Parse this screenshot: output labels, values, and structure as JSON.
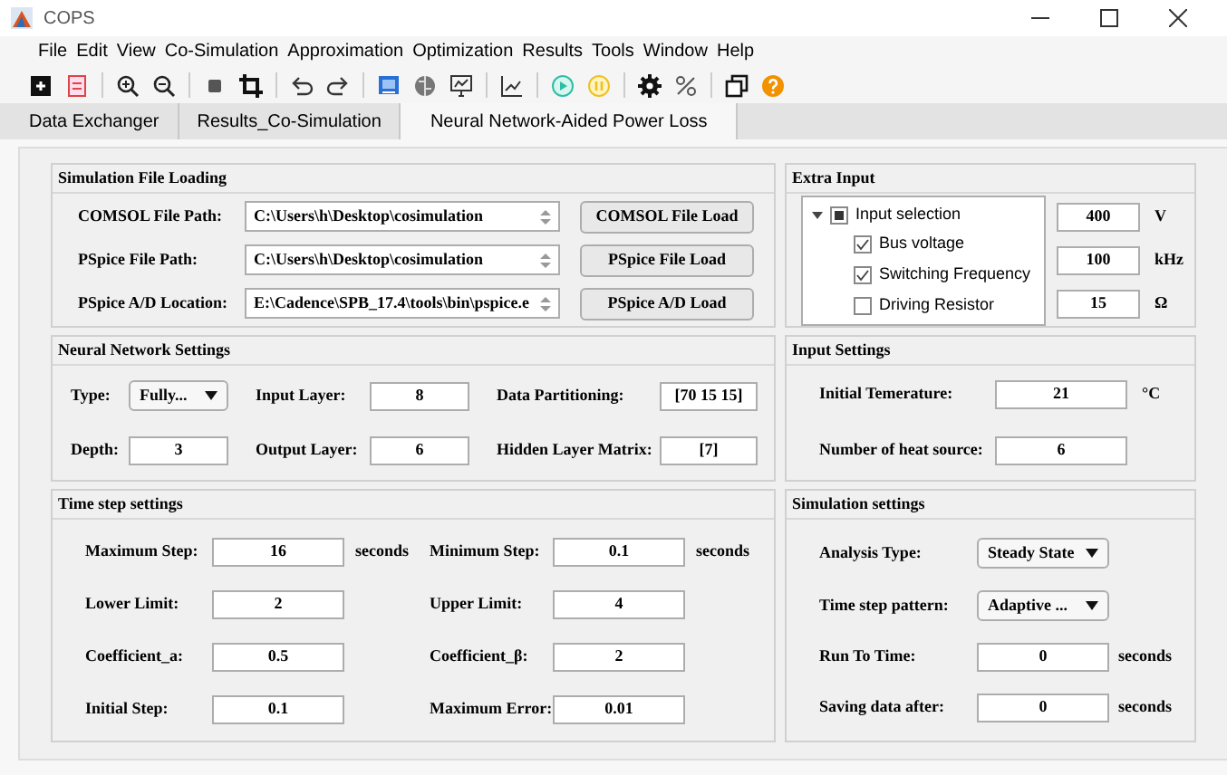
{
  "window": {
    "title": "COPS"
  },
  "menu": [
    "File",
    "Edit",
    "View",
    "Co-Simulation",
    "Approximation",
    "Optimization",
    "Results",
    "Tools",
    "Window",
    "Help"
  ],
  "tabs": [
    {
      "label": "Data Exchanger",
      "selected": false
    },
    {
      "label": "Results_Co-Simulation",
      "selected": false
    },
    {
      "label": "Neural Network-Aided Power Loss",
      "selected": true
    }
  ],
  "simulation_file_loading": {
    "title": "Simulation File Loading",
    "rows": [
      {
        "label": "COMSOL File Path:",
        "value": "C:\\Users\\h\\Desktop\\cosimulation",
        "button": "COMSOL File Load"
      },
      {
        "label": "PSpice File Path:",
        "value": "C:\\Users\\h\\Desktop\\cosimulation",
        "button": "PSpice File Load"
      },
      {
        "label": "PSpice A/D Location:",
        "value": "E:\\Cadence\\SPB_17.4\\tools\\bin\\pspice.e",
        "button": "PSpice A/D Load"
      }
    ]
  },
  "extra_input": {
    "title": "Extra Input",
    "tree": {
      "label": "Input selection",
      "expanded": true,
      "indeterminate": true,
      "children": [
        {
          "label": "Bus voltage",
          "checked": true
        },
        {
          "label": "Switching Frequency",
          "checked": true
        },
        {
          "label": "Driving Resistor",
          "checked": false
        }
      ]
    },
    "values": [
      {
        "value": "400",
        "unit": "V"
      },
      {
        "value": "100",
        "unit": "kHz"
      },
      {
        "value": "15",
        "unit": "Ω"
      }
    ]
  },
  "neural_network_settings": {
    "title": "Neural Network Settings",
    "rows": [
      [
        {
          "kind": "dropdown",
          "label": "Type:",
          "value": "Fully..."
        },
        {
          "kind": "field",
          "label": "Input Layer:",
          "value": "8"
        },
        {
          "kind": "field",
          "label": "Data Partitioning:",
          "value": "[70 15 15]"
        }
      ],
      [
        {
          "kind": "field",
          "label": "Depth:",
          "value": "3"
        },
        {
          "kind": "field",
          "label": "Output Layer:",
          "value": "6"
        },
        {
          "kind": "field",
          "label": "Hidden Layer Matrix:",
          "value": "[7]"
        }
      ]
    ]
  },
  "input_settings": {
    "title": "Input Settings",
    "rows": [
      {
        "label": "Initial Temerature:",
        "value": "21",
        "unit": "°C"
      },
      {
        "label": "Number of heat source:",
        "value": "6"
      }
    ]
  },
  "time_step_settings": {
    "title": "Time step  settings",
    "rows": [
      [
        {
          "label": "Maximum Step:",
          "value": "16",
          "unit": "seconds"
        },
        {
          "label": "Minimum Step:",
          "value": "0.1",
          "unit": "seconds"
        }
      ],
      [
        {
          "label": "Lower Limit:",
          "value": "2"
        },
        {
          "label": "Upper Limit:",
          "value": "4"
        }
      ],
      [
        {
          "label": "Coefficient_a:",
          "value": "0.5"
        },
        {
          "label": "Coefficient_β:",
          "value": "2"
        }
      ],
      [
        {
          "label": "Initial  Step:",
          "value": "0.1"
        },
        {
          "label": "Maximum Error:",
          "value": "0.01"
        }
      ]
    ]
  },
  "simulation_settings": {
    "title": "Simulation settings",
    "rows": [
      {
        "kind": "dropdown",
        "label": "Analysis Type:",
        "value": "Steady State"
      },
      {
        "kind": "dropdown",
        "label": "Time step pattern:",
        "value": "Adaptive ..."
      },
      {
        "kind": "field",
        "label": "Run To Time:",
        "value": "0",
        "unit": "seconds"
      },
      {
        "kind": "field",
        "label": "Saving data after:",
        "value": "0",
        "unit": "seconds"
      }
    ]
  }
}
